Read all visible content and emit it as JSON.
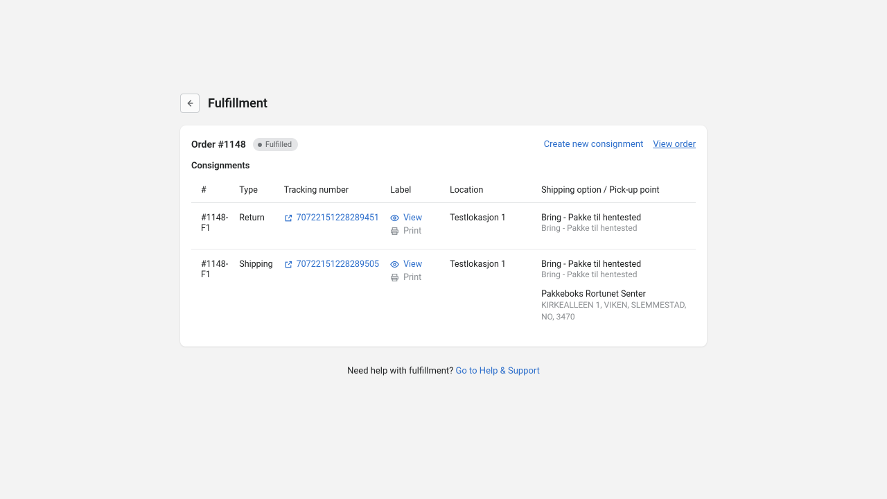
{
  "header": {
    "title": "Fulfillment"
  },
  "card": {
    "order_label": "Order #1148",
    "badge": "Fulfilled",
    "create_consignment": "Create new consignment",
    "view_order": "View order",
    "section": "Consignments"
  },
  "table": {
    "headers": {
      "id": "#",
      "type": "Type",
      "tracking": "Tracking number",
      "label": "Label",
      "location": "Location",
      "shipping": "Shipping option / Pick-up point"
    },
    "rows": [
      {
        "id": "#1148-F1",
        "type": "Return",
        "tracking": "70722151228289451",
        "view": "View",
        "print": "Print",
        "location": "Testlokasjon 1",
        "ship_main": "Bring - Pakke til hentested",
        "ship_sub": "Bring - Pakke til hentested",
        "pickup_name": "",
        "pickup_addr": ""
      },
      {
        "id": "#1148-F1",
        "type": "Shipping",
        "tracking": "70722151228289505",
        "view": "View",
        "print": "Print",
        "location": "Testlokasjon 1",
        "ship_main": "Bring - Pakke til hentested",
        "ship_sub": "Bring - Pakke til hentested",
        "pickup_name": "Pakkeboks Rortunet Senter",
        "pickup_addr": "KIRKEALLEEN 1, VIKEN, SLEMMESTAD, NO, 3470"
      }
    ]
  },
  "footer": {
    "text": "Need help with fulfillment? ",
    "link": "Go to Help & Support"
  }
}
